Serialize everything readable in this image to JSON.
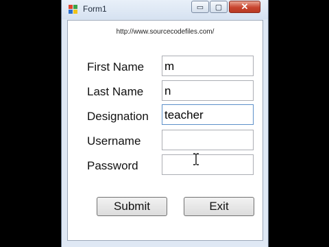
{
  "window": {
    "title": "Form1",
    "controls": {
      "minimize": "▭",
      "maximize": "▢",
      "close": "✕"
    }
  },
  "form": {
    "url": "http://www.sourcecodefiles.com/",
    "fields": [
      {
        "label": "First Name",
        "value": "m"
      },
      {
        "label": "Last Name",
        "value": "n"
      },
      {
        "label": "Designation",
        "value": "teacher"
      },
      {
        "label": "Username",
        "value": ""
      },
      {
        "label": "Password",
        "value": ""
      }
    ],
    "buttons": {
      "submit": "Submit",
      "exit": "Exit"
    }
  },
  "colors": {
    "window_bg": "#dfe8f4",
    "close_button": "#c8452f",
    "focus_border": "#5b8fc9"
  },
  "icons": [
    "app-icon",
    "minimize-icon",
    "maximize-icon",
    "close-icon",
    "text-cursor-icon"
  ]
}
